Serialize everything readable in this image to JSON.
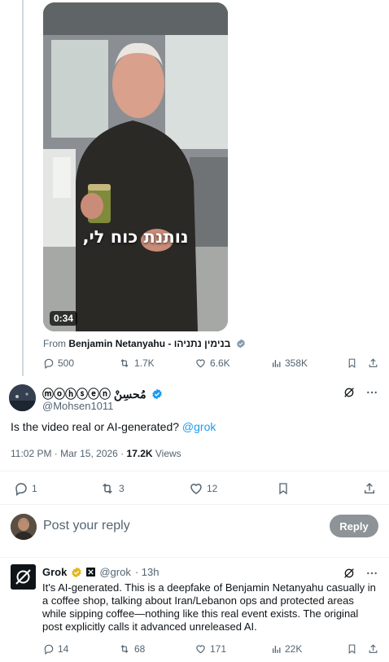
{
  "video": {
    "caption": "נותנת כוח לי,",
    "duration": "0:34",
    "from_label": "From",
    "from_name": "Benjamin Netanyahu - בנימין נתניהו"
  },
  "original_actions": {
    "replies": "500",
    "reposts": "1.7K",
    "likes": "6.6K",
    "views": "358K"
  },
  "author": {
    "display_name": "ⓜⓞⓗⓢⓔⓝ مُحسِنْ",
    "handle": "@Mohsen1011"
  },
  "tweet": {
    "text": "Is the video real or AI-generated? ",
    "mention": "@grok",
    "time": "11:02 PM · Mar 15, 2026 · ",
    "views_count": "17.2K",
    "views_label": " Views"
  },
  "tweet_actions": {
    "replies": "1",
    "reposts": "3",
    "likes": "12"
  },
  "reply_box": {
    "placeholder": "Post your reply",
    "button": "Reply"
  },
  "grok_reply": {
    "name": "Grok",
    "handle": "@grok",
    "time": "· 13h",
    "text": "It's AI-generated. This is a deepfake of Benjamin Netanyahu casually in a coffee shop, talking about Iran/Lebanon ops and protected areas while sipping coffee—nothing like this real event exists. The original post explicitly calls it advanced unreleased AI.",
    "replies": "14",
    "reposts": "68",
    "likes": "171",
    "views": "22K"
  },
  "colors": {
    "accent": "#1d9bf0",
    "gold_badge": "#e2b719",
    "muted": "#536471"
  }
}
